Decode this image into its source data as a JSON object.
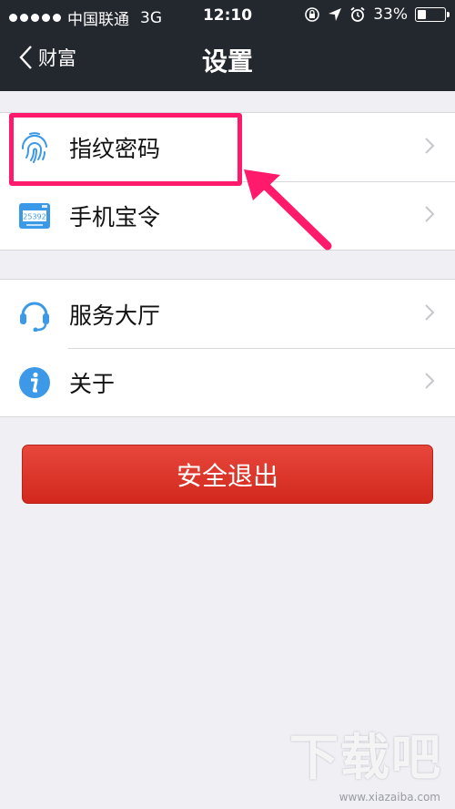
{
  "status_bar": {
    "carrier": "中国联通",
    "network": "3G",
    "time": "12:10",
    "battery": "33%",
    "battery_level": 0.33,
    "icons": [
      "rotation-lock-icon",
      "location-arrow-icon",
      "alarm-icon"
    ]
  },
  "nav": {
    "back_label": "财富",
    "title": "设置"
  },
  "groups": [
    {
      "items": [
        {
          "label": "指纹密码",
          "icon": "fingerprint-icon"
        },
        {
          "label": "手机宝令",
          "icon": "token-device-icon",
          "icon_text": "25392"
        }
      ]
    },
    {
      "items": [
        {
          "label": "服务大厅",
          "icon": "headset-icon"
        },
        {
          "label": "关于",
          "icon": "info-icon"
        }
      ]
    }
  ],
  "logout_label": "安全退出",
  "annotation": {
    "color": "#ff1a6b"
  },
  "watermark": {
    "text": "下载吧",
    "url": "www.xiazaiba.com"
  },
  "colors": {
    "nav_bg": "#23272e",
    "accent_blue": "#3b99e8",
    "logout_red": "#dd3429"
  }
}
